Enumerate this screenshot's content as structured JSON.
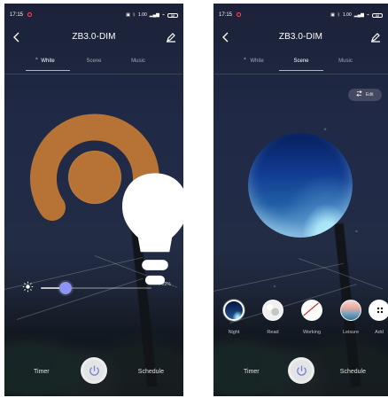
{
  "colors": {
    "accent_ring": "#b67335",
    "slider_thumb": "#8d94f6",
    "background_dark": "#1b2238"
  },
  "screens": [
    {
      "status": {
        "time": "17:15",
        "icons": [
          "recording-dot",
          "screen-icon",
          "bluetooth-icon",
          "speed-icon",
          "cellular-icon",
          "wifi-icon",
          "battery-icon"
        ],
        "speed": "1.00",
        "battery": "88"
      },
      "title": "ZB3.0-DIM",
      "tabs": [
        {
          "label": "White",
          "active": true
        },
        {
          "label": "Scene",
          "active": false
        },
        {
          "label": "Music",
          "active": false
        }
      ],
      "brightness_percent": "22%",
      "brightness_level": 0.22,
      "bottom": {
        "timer": "Timer",
        "schedule": "Schedule"
      }
    },
    {
      "status": {
        "time": "17:15",
        "icons": [
          "recording-dot",
          "screen-icon",
          "bluetooth-icon",
          "speed-icon",
          "cellular-icon",
          "wifi-icon",
          "battery-icon"
        ],
        "speed": "1.00",
        "battery": "88"
      },
      "title": "ZB3.0-DIM",
      "tabs": [
        {
          "label": "White",
          "active": false
        },
        {
          "label": "Scene",
          "active": true
        },
        {
          "label": "Music",
          "active": false
        }
      ],
      "edit_label": "Edit",
      "scenes": [
        {
          "label": "Night",
          "icon": "night-scene",
          "selected": true
        },
        {
          "label": "Read",
          "icon": "read-scene",
          "selected": false
        },
        {
          "label": "Working",
          "icon": "working-scene",
          "selected": false
        },
        {
          "label": "Leisure",
          "icon": "leisure-scene",
          "selected": false
        },
        {
          "label": "Add",
          "icon": "add-scene",
          "selected": false
        }
      ],
      "bottom": {
        "timer": "Timer",
        "schedule": "Schedule"
      }
    }
  ]
}
